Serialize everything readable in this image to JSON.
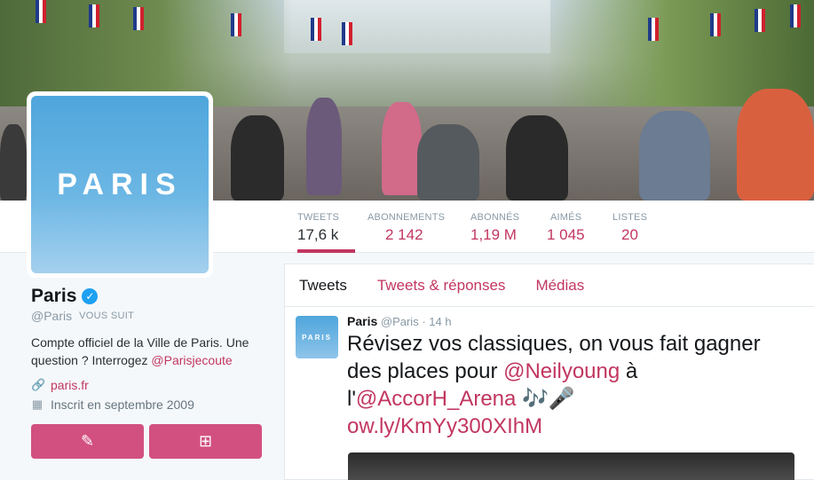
{
  "profile": {
    "avatar_text": "PARIS",
    "name": "Paris",
    "verified_icon": "verified-badge-icon",
    "handle": "@Paris",
    "follows_you": "VOUS SUIT",
    "bio_text": "Compte officiel de la Ville de Paris. Une question ? Interrogez ",
    "bio_mention": "@Parisjecoute",
    "link": "paris.fr",
    "joined": "Inscrit en septembre 2009"
  },
  "stats": [
    {
      "label": "TWEETS",
      "value": "17,6 k"
    },
    {
      "label": "ABONNEMENTS",
      "value": "2 142"
    },
    {
      "label": "ABONNÉS",
      "value": "1,19 M"
    },
    {
      "label": "AIMÉS",
      "value": "1 045"
    },
    {
      "label": "LISTES",
      "value": "20"
    }
  ],
  "tabs": [
    "Tweets",
    "Tweets & réponses",
    "Médias"
  ],
  "tweet": {
    "avatar_text": "PARIS",
    "name": "Paris",
    "handle": "@Paris",
    "separator": "·",
    "time": "14 h",
    "text_1": "Révisez vos classiques, on vous fait gagner des places pour ",
    "mention_1": "@Neilyoung",
    "text_2": " à l'",
    "mention_2": "@AccorH_Arena",
    "emoji": "🎶🎤",
    "link": "ow.ly/KmYy300XIhM"
  },
  "colors": {
    "accent": "#c23660",
    "button": "#d2507f",
    "avatar": "#4fa6dc"
  }
}
